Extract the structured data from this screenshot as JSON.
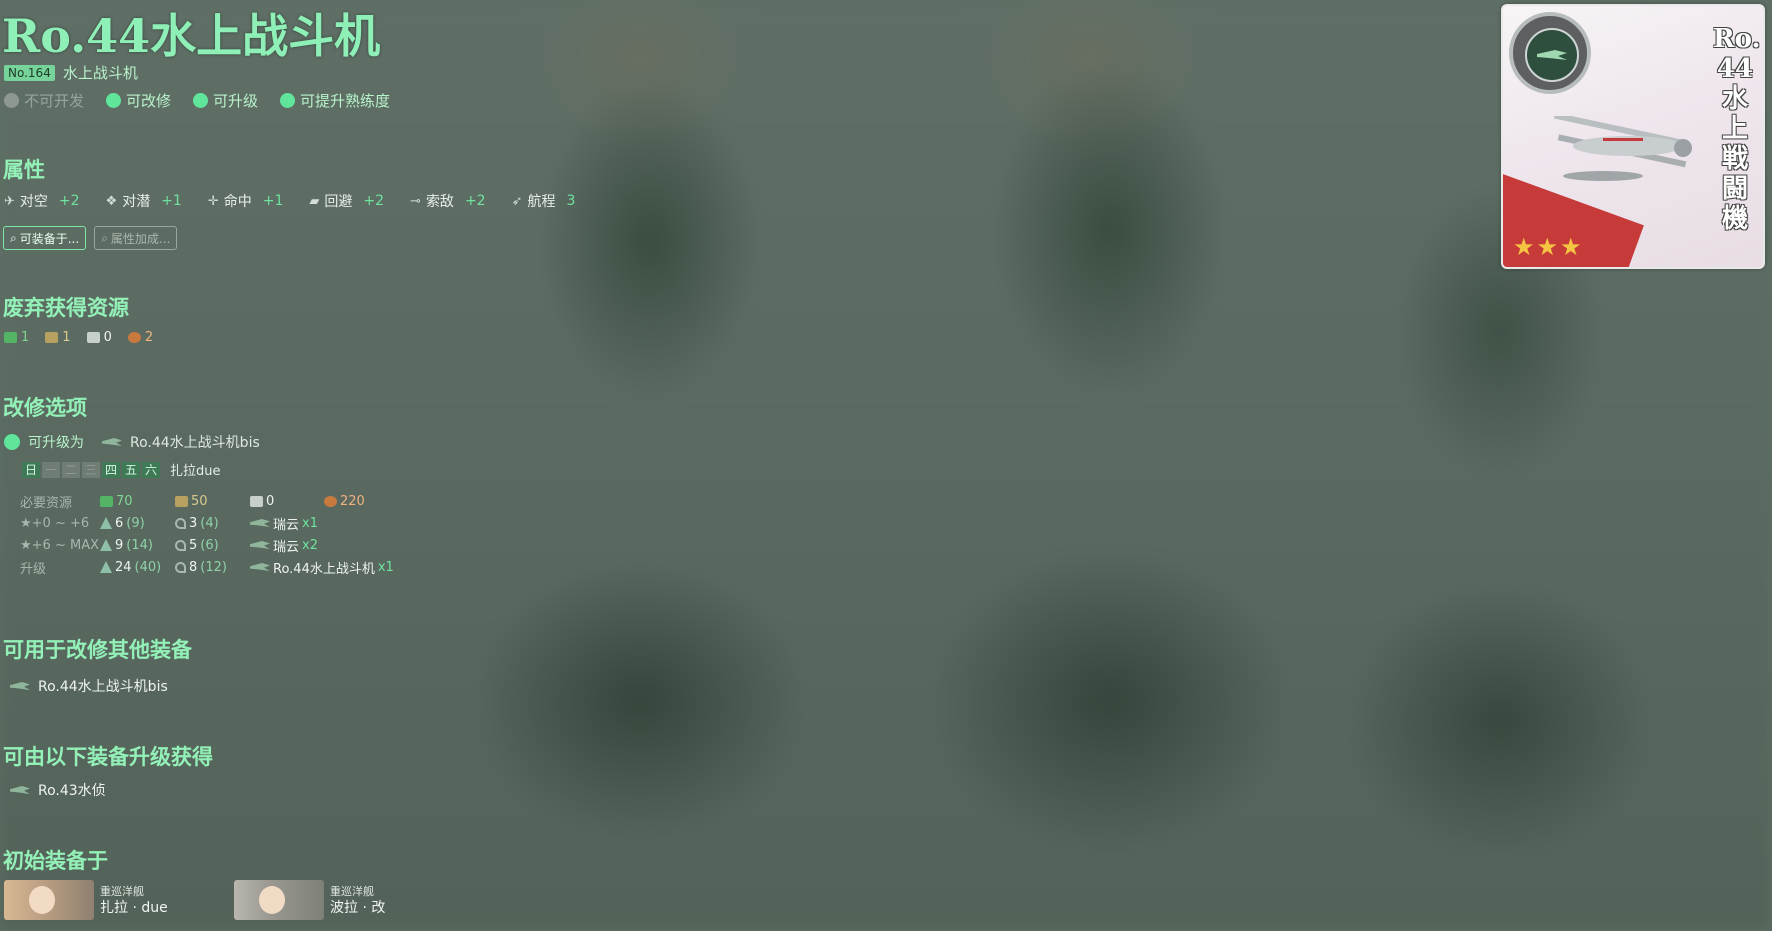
{
  "equipment": {
    "name": "Ro.44水上战斗机",
    "no_label": "No.164",
    "type": "水上战斗机",
    "flags": [
      {
        "label": "不可开发",
        "active": false
      },
      {
        "label": "可改修",
        "active": true
      },
      {
        "label": "可升级",
        "active": true
      },
      {
        "label": "可提升熟练度",
        "active": true
      }
    ]
  },
  "sections": {
    "attributes": "属性",
    "scrap": "废弃获得资源",
    "improvement": "改修选项",
    "used_for": "可用于改修其他装备",
    "upgraded_from": "可由以下装备升级获得",
    "initial": "初始装备于"
  },
  "stats": [
    {
      "label": "对空",
      "value": "+2",
      "icon": "aa-icon"
    },
    {
      "label": "对潜",
      "value": "+1",
      "icon": "asw-icon"
    },
    {
      "label": "命中",
      "value": "+1",
      "icon": "accuracy-icon"
    },
    {
      "label": "回避",
      "value": "+2",
      "icon": "evasion-icon"
    },
    {
      "label": "索敌",
      "value": "+2",
      "icon": "los-icon"
    },
    {
      "label": "航程",
      "value": "3",
      "icon": "range-icon"
    }
  ],
  "buttons": {
    "equippable": "可装备于...",
    "bonus": "属性加成..."
  },
  "scrap": {
    "fuel": "1",
    "ammo": "1",
    "steel": "0",
    "bauxite": "2"
  },
  "improvement": {
    "upgrade_label": "可升级为",
    "upgrade_target": "Ro.44水上战斗机bis",
    "days": [
      {
        "label": "日",
        "on": true
      },
      {
        "label": "一",
        "on": false
      },
      {
        "label": "二",
        "on": false
      },
      {
        "label": "三",
        "on": false
      },
      {
        "label": "四",
        "on": true
      },
      {
        "label": "五",
        "on": true
      },
      {
        "label": "六",
        "on": true
      }
    ],
    "helper_ship": "扎拉due",
    "resources_label": "必要资源",
    "resources": {
      "fuel": "70",
      "ammo": "50",
      "steel": "0",
      "bauxite": "220"
    },
    "rows": [
      {
        "label": "★+0 ~ +6",
        "dev": "6",
        "dev_sure": "(9)",
        "screw": "3",
        "screw_sure": "(4)",
        "item": "瑞云",
        "count": "x1"
      },
      {
        "label": "★+6 ~ MAX",
        "dev": "9",
        "dev_sure": "(14)",
        "screw": "5",
        "screw_sure": "(6)",
        "item": "瑞云",
        "count": "x2"
      },
      {
        "label": "升级",
        "dev": "24",
        "dev_sure": "(40)",
        "screw": "8",
        "screw_sure": "(12)",
        "item": "Ro.44水上战斗机",
        "count": "x1"
      }
    ]
  },
  "used_for": [
    "Ro.44水上战斗机bis"
  ],
  "upgraded_from": [
    "Ro.43水侦"
  ],
  "initial_ships": [
    {
      "type": "重巡洋舰",
      "name": "扎拉 · due"
    },
    {
      "type": "重巡洋舰",
      "name": "波拉 · 改"
    }
  ],
  "card": {
    "vertical_name": [
      "Ro.",
      "44",
      "水",
      "上",
      "戦",
      "闘",
      "機"
    ],
    "stars": "★★★"
  },
  "colors": {
    "accent": "#8ef0b6",
    "green_value": "#6fe29f",
    "bg": "#5d6e64"
  }
}
